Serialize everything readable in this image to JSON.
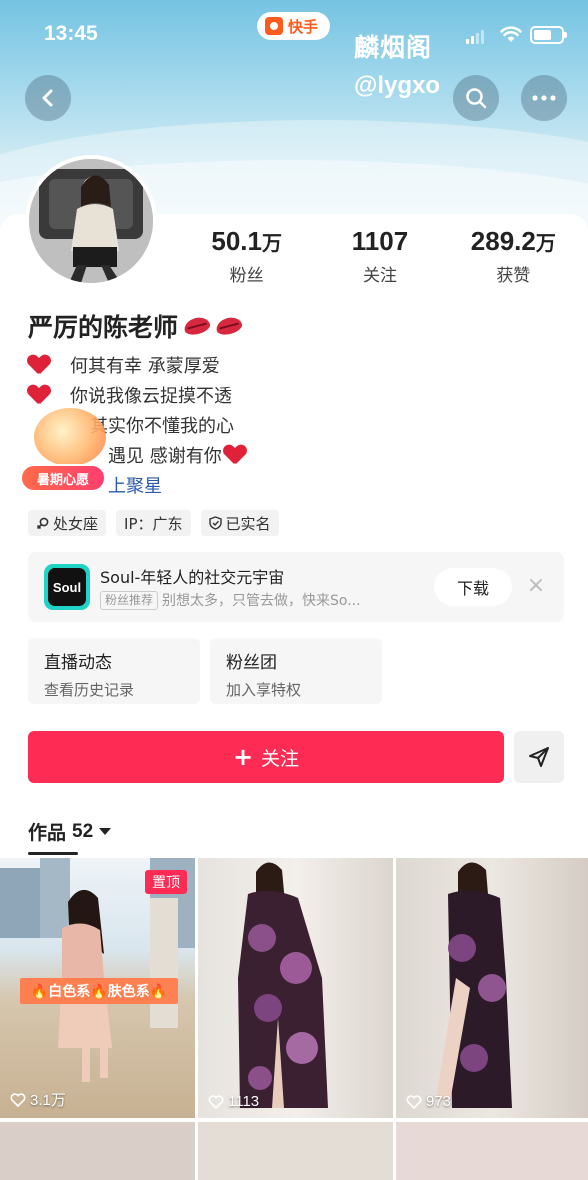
{
  "status_bar": {
    "time": "13:45",
    "app_name": "快手"
  },
  "watermark": {
    "line1": "麟烟阁",
    "line2": "@lygxo"
  },
  "profile": {
    "nickname": "严厉的陈老师",
    "stats": [
      {
        "num": "50.1",
        "unit": "万",
        "label": "粉丝"
      },
      {
        "num": "1107",
        "unit": "",
        "label": "关注"
      },
      {
        "num": "289.2",
        "unit": "万",
        "label": "获赞"
      }
    ],
    "bio": [
      "何其有幸 承蒙厚爱",
      "你说我像云捉摸不透",
      "其实你不懂我的心",
      "遇见 感谢有你"
    ],
    "bio_more": "上聚星",
    "wish_badge": "暑期心愿",
    "tags": [
      "处女座",
      "IP：广东",
      "已实名"
    ]
  },
  "ad": {
    "logo_text": "Soul",
    "title": "Soul-年轻人的社交元宇宙",
    "chip": "粉丝推荐",
    "subtitle": "别想太多，只管去做，快来So...",
    "download_label": "下载",
    "close_label": "×"
  },
  "entries": [
    {
      "title": "直播动态",
      "subtitle": "查看历史记录"
    },
    {
      "title": "粉丝团",
      "subtitle": "加入享特权"
    }
  ],
  "actions": {
    "follow_label": "关注",
    "follow_icon": "+"
  },
  "works": {
    "tab_label": "作品",
    "count": "52",
    "items": [
      {
        "likes": "3.1万",
        "pinned": "置顶",
        "color_tag": "🔥白色系🔥肤色系🔥"
      },
      {
        "likes": "1113"
      },
      {
        "likes": "973"
      }
    ]
  },
  "colors": {
    "accent": "#fe2c55",
    "link": "#2b5aa8",
    "cover_top": "#74c3e2"
  },
  "icons": [
    "back-icon",
    "search-icon",
    "more-icon",
    "share-icon",
    "heart-icon",
    "location-icon",
    "verified-icon",
    "close-icon"
  ]
}
